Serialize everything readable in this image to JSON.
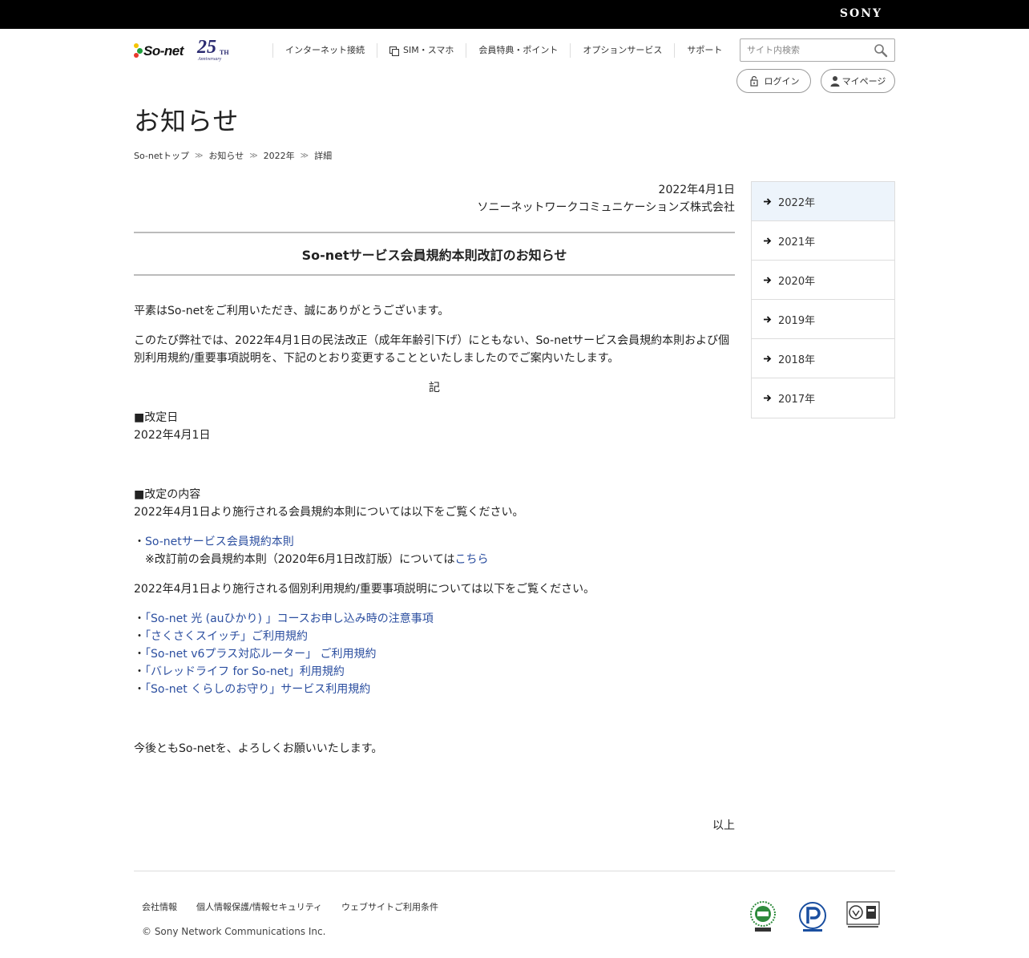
{
  "brand": {
    "sony": "SONY",
    "logo_word": "So-net",
    "anniv_num": "25",
    "anniv_th": "TH",
    "anniv_text": "Anniversary"
  },
  "nav": {
    "items": [
      {
        "label": "インターネット接続"
      },
      {
        "label": "SIM・スマホ"
      },
      {
        "label": "会員特典・ポイント"
      },
      {
        "label": "オプションサービス"
      },
      {
        "label": "サポート"
      }
    ]
  },
  "search": {
    "placeholder": "サイト内検索"
  },
  "account": {
    "login_label": "ログイン",
    "mypage_label": "マイページ"
  },
  "page": {
    "title": "お知らせ"
  },
  "breadcrumb": [
    "So-netトップ",
    "お知らせ",
    "2022年",
    "詳細"
  ],
  "article": {
    "date": "2022年4月1日",
    "company": "ソニーネットワークコミュニケーションズ株式会社",
    "title": "So-netサービス会員規約本則改訂のお知らせ",
    "greeting": "平素はSo-netをご利用いただき、誠にありがとうございます。",
    "intro": "このたび弊社では、2022年4月1日の民法改正（成年年齢引下げ）にともない、So-netサービス会員規約本則および個別利用規約/重要事項説明を、下記のとおり変更することといたしましたのでご案内いたします。",
    "ki": "記",
    "revision_date_heading": "■改定日",
    "revision_date": "2022年4月1日",
    "content_heading": "■改定の内容",
    "content_text": "2022年4月1日より施行される会員規約本則については以下をご覧ください。",
    "bullet": "・",
    "main_link": "So-netサービス会員規約本則",
    "note_prefix": "※改訂前の会員規約本則（2020年6月1日改訂版）については",
    "note_link": "こちら",
    "individual_text": "2022年4月1日より施行される個別利用規約/重要事項説明については以下をご覧ください。",
    "individual_links": [
      "「So-net 光 (auひかり) 」コースお申し込み時の注意事項",
      "「さくさくスイッチ」ご利用規約",
      "「So-net v6プラス対応ルーター」 ご利用規約",
      "「バレッドライフ for So-net」利用規約",
      "「So-net くらしのお守り」サービス利用規約"
    ],
    "closing": "今後ともSo-netを、よろしくお願いいたします。",
    "end": "以上"
  },
  "sidebar": {
    "years": [
      {
        "label": "2022年"
      },
      {
        "label": "2021年"
      },
      {
        "label": "2020年"
      },
      {
        "label": "2019年"
      },
      {
        "label": "2018年"
      },
      {
        "label": "2017年"
      }
    ]
  },
  "footer": {
    "links": [
      "会社情報",
      "個人情報保護/情報セキュリティ",
      "ウェブサイトご利用条件"
    ],
    "copyright": "© Sony Network Communications Inc."
  },
  "colors": {
    "link": "#2c4fa0",
    "active_bg": "#edf4fb",
    "top_bar": "#000000"
  }
}
